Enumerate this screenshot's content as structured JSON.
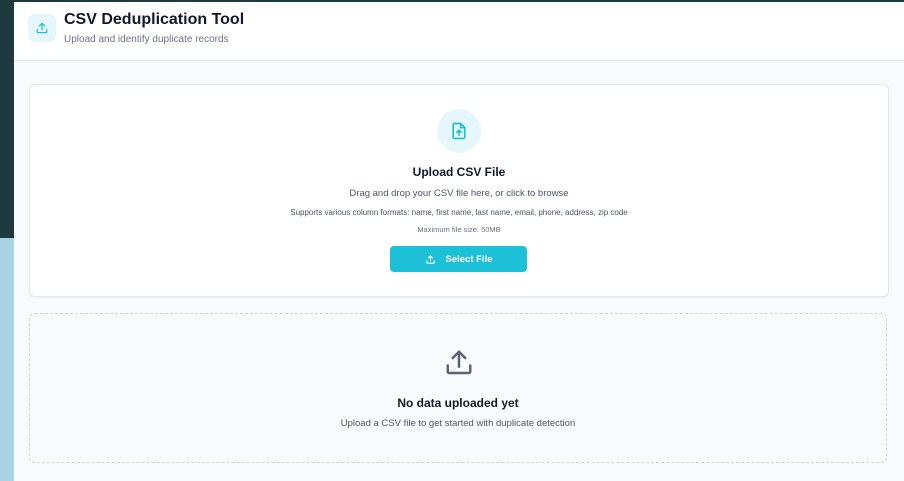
{
  "colors": {
    "accent": "#1ec0d8",
    "accent_light": "#e6f7fb",
    "title_text": "#111827",
    "muted_text": "#6b7280"
  },
  "header": {
    "icon": "upload-icon",
    "title": "CSV Deduplication Tool",
    "subtitle": "Upload and identify duplicate records"
  },
  "upload": {
    "icon": "file-upload-icon",
    "title": "Upload CSV File",
    "description": "Drag and drop your CSV file here, or click to browse",
    "formats": "Supports various column formats: name, first name, last name, email, phone, address, zip code",
    "max_size": "Maximum file size: 50MB",
    "button_icon": "upload-icon",
    "button_label": "Select File"
  },
  "empty_state": {
    "icon": "upload-icon",
    "title": "No data uploaded yet",
    "description": "Upload a CSV file to get started with duplicate detection"
  }
}
